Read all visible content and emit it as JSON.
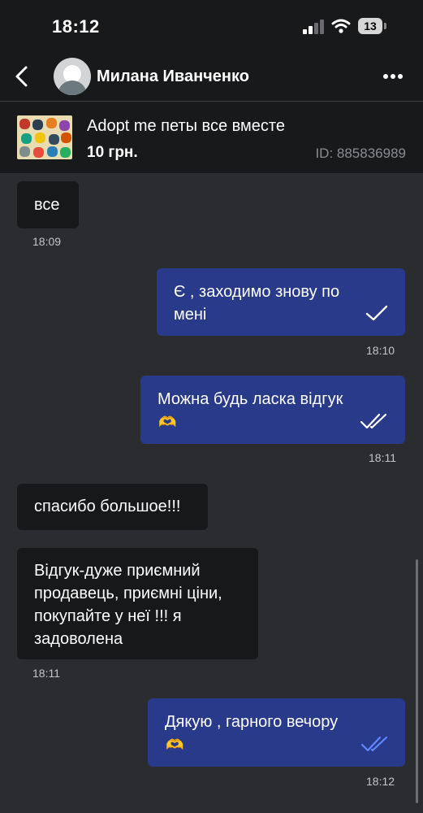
{
  "status_bar": {
    "time": "18:12",
    "battery": "13",
    "icons": [
      "signal-icon",
      "wifi-icon",
      "battery-icon"
    ]
  },
  "header": {
    "contact_name": "Милана Иванченко",
    "icons": [
      "back-chevron-icon",
      "more-dots-icon"
    ]
  },
  "listing": {
    "title": "Adopt me петы все вместе",
    "price": "10 грн.",
    "id": "ID: 885836989"
  },
  "messages": [
    {
      "dir": "in",
      "text": "все",
      "time": "18:09"
    },
    {
      "dir": "out",
      "text": "Є , заходимо знову по мені",
      "time": "18:10",
      "status": "sent"
    },
    {
      "dir": "out",
      "text": "Можна будь ласка відгук",
      "emoji": "🫶",
      "time": "18:11",
      "status": "delivered"
    },
    {
      "dir": "in",
      "text": "спасибо большое!!!"
    },
    {
      "dir": "in",
      "text": "Відгук-дуже приємний продавець, приємні ціни, покупайте у неї !!! я задоволена",
      "time": "18:11"
    },
    {
      "dir": "out",
      "text": "Дякую , гарного вечору",
      "emoji": "🫶",
      "time": "18:12",
      "status": "read"
    }
  ],
  "colors": {
    "background": "#2b2c30",
    "bar": "#18191b",
    "incoming_bubble": "#17181a",
    "outgoing_bubble": "#293a8a",
    "read_ticks": "#5f87ff"
  }
}
